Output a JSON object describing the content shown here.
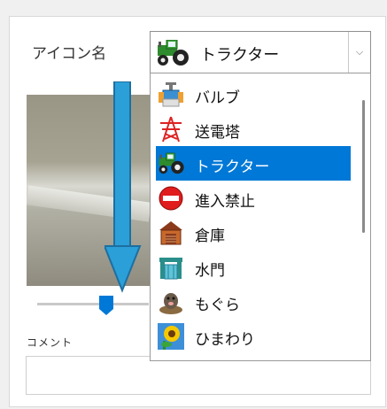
{
  "field": {
    "label": "アイコン名"
  },
  "combo": {
    "selected_label": "トラクター",
    "selected_icon": "tractor-icon",
    "dropdown_glyph": "⌵"
  },
  "list": {
    "items": [
      {
        "label": "バルブ",
        "icon": "valve-icon"
      },
      {
        "label": "送電塔",
        "icon": "power-tower-icon"
      },
      {
        "label": "トラクター",
        "icon": "tractor-icon",
        "selected": true
      },
      {
        "label": "進入禁止",
        "icon": "no-entry-icon"
      },
      {
        "label": "倉庫",
        "icon": "warehouse-icon"
      },
      {
        "label": "水門",
        "icon": "water-gate-icon"
      },
      {
        "label": "もぐら",
        "icon": "mole-icon"
      },
      {
        "label": "ひまわり",
        "icon": "sunflower-icon"
      }
    ]
  },
  "comment": {
    "label": "コメント",
    "value": ""
  },
  "colors": {
    "selection": "#0078d7",
    "arrow": "#2b9fd8"
  }
}
